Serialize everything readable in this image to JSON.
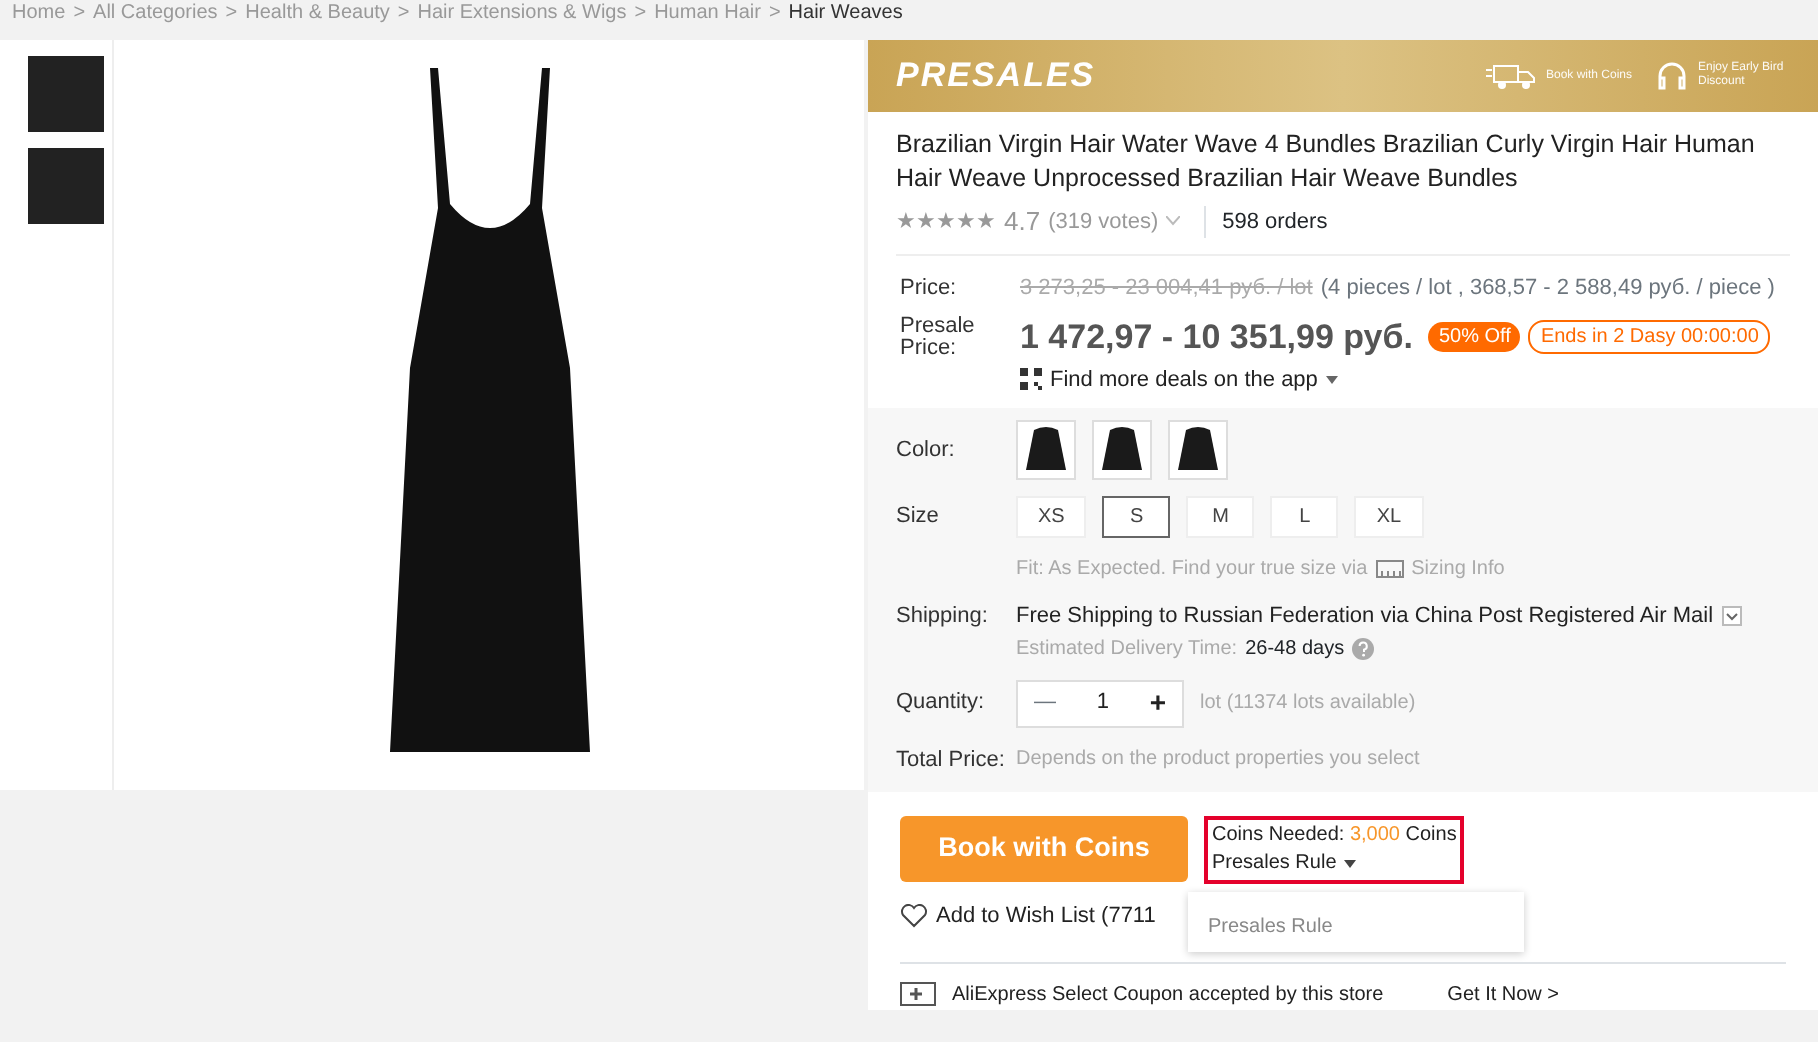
{
  "breadcrumb_separator": ">",
  "breadcrumb": [
    "Home",
    "All Categories",
    "Health & Beauty",
    "Hair Extensions & Wigs",
    "Human Hair",
    "Hair Weaves"
  ],
  "banner": {
    "title": "PRESALES",
    "features": [
      "Book with Coins",
      "Enjoy Early Bird Discount"
    ]
  },
  "product": {
    "title": "Brazilian Virgin Hair Water Wave 4 Bundles Brazilian Curly Virgin Hair Human Hair Weave Unprocessed Brazilian Hair Weave Bundles",
    "stars": 5,
    "rating": "4.7",
    "votes": "(319 votes)",
    "orders": "598 orders"
  },
  "price": {
    "label": "Price:",
    "original": "3 273,25 - 23 004,41 руб. / lot",
    "note": "(4 pieces / lot , 368,57 - 2 588,49 руб. / piece )",
    "presale_label": "Presale Price:",
    "presale": "1 472,97 - 10 351,99 руб.",
    "discount": "50% Off",
    "countdown": "Ends in 2 Dasy 00:00:00",
    "app_link": "Find more deals on the app"
  },
  "color": {
    "label": "Color:",
    "swatches": [
      {
        "selected": false
      },
      {
        "selected": false
      },
      {
        "selected": false
      }
    ]
  },
  "size": {
    "label": "Size",
    "options": [
      {
        "label": "XS",
        "selected": false
      },
      {
        "label": "S",
        "selected": true
      },
      {
        "label": "M",
        "selected": false
      },
      {
        "label": "L",
        "selected": false
      },
      {
        "label": "XL",
        "selected": false
      }
    ],
    "fit_note": "Fit: As Expected. Find your true size via",
    "sizing_link": "Sizing Info"
  },
  "shipping": {
    "label": "Shipping:",
    "text": "Free Shipping to Russian Federation via China Post Registered Air Mail",
    "delivery_label": "Estimated Delivery Time:",
    "delivery_value": "26-48 days"
  },
  "quantity": {
    "label": "Quantity:",
    "minus": "—",
    "value": "1",
    "plus": "+",
    "availability": "lot (11374 lots available)"
  },
  "total": {
    "label": "Total Price:",
    "value": "Depends on the product properties you select"
  },
  "book_button": "Book with Coins",
  "coins": {
    "prefix": "Coins Needed:",
    "amount": "3,000",
    "suffix": "Coins",
    "rule_link": "Presales Rule"
  },
  "rule_dropdown": {
    "expanded": true,
    "items": [
      "Presales Rule"
    ]
  },
  "wishlist": "Add to Wish List (7711",
  "coupon": {
    "text": "AliExpress Select Coupon accepted by this store",
    "action": "Get It Now >"
  }
}
